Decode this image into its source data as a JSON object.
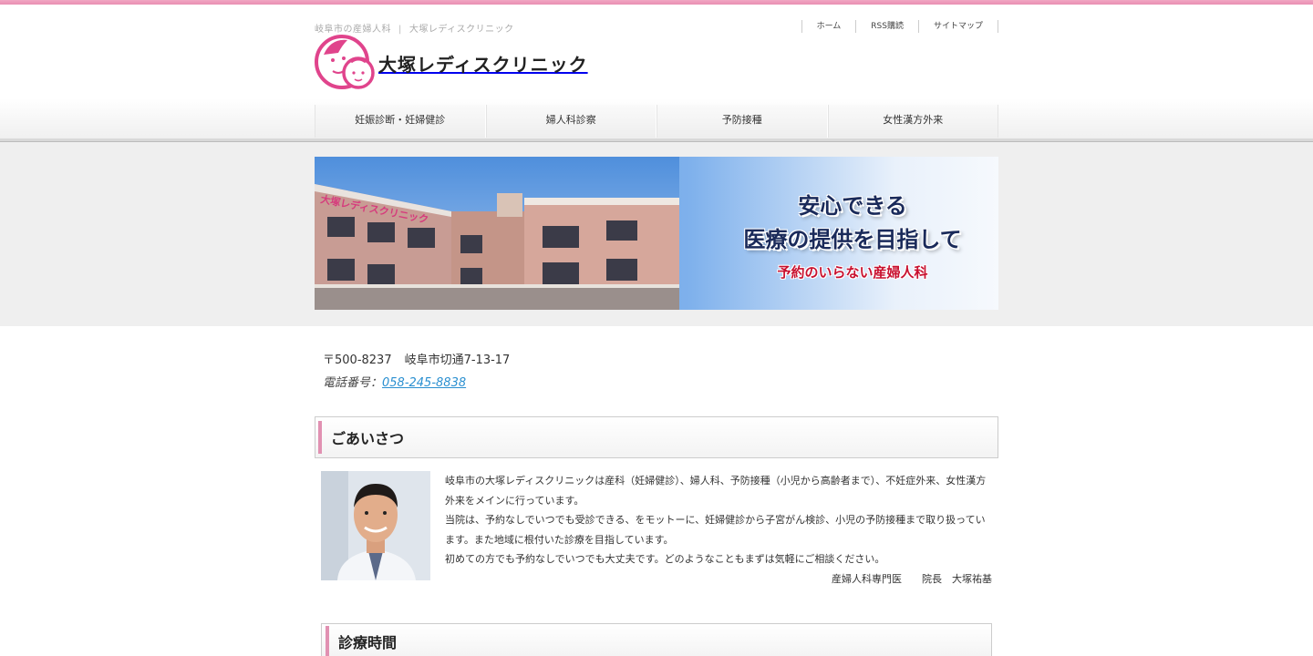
{
  "header": {
    "tagline_left": "岐阜市の産婦人科",
    "tagline_sep": "|",
    "tagline_right": "大塚レディスクリニック",
    "logo_text": "大塚レディスクリニック",
    "utility_nav": [
      "ホーム",
      "RSS購読",
      "サイトマップ"
    ]
  },
  "global_nav": [
    "妊娠診断・妊婦健診",
    "婦人科診察",
    "予防接種",
    "女性漢方外来"
  ],
  "hero": {
    "line1": "安心できる",
    "line2": "医療の提供を目指して",
    "line3": "予約のいらない産婦人科",
    "sign_text": "大塚レディスクリニック"
  },
  "address": {
    "postal": "〒500-8237",
    "street": "岐阜市切通7-13-17",
    "phone_label": "電話番号：",
    "phone": "058-245-8838"
  },
  "greeting": {
    "title": "ごあいさつ",
    "paragraphs": [
      "岐阜市の大塚レディスクリニックは産科（妊婦健診）、婦人科、予防接種（小児から高齢者まで）、不妊症外来、女性漢方外来をメインに行っています。",
      "当院は、予約なしでいつでも受診できる、をモットーに、妊婦健診から子宮がん検診、小児の予防接種まで取り扱っています。また地域に根付いた診療を目指しています。",
      "初めての方でも予約なしでいつでも大丈夫です。どのようなこともまずは気軽にご相談ください。"
    ],
    "signature_role": "産婦人科専門医",
    "signature_name": "院長　大塚祐基"
  },
  "hours": {
    "title": "診療時間"
  },
  "colors": {
    "accent_pink": "#e191b2",
    "link_blue": "#2a8fd0",
    "logo_pink": "#e0448c"
  }
}
